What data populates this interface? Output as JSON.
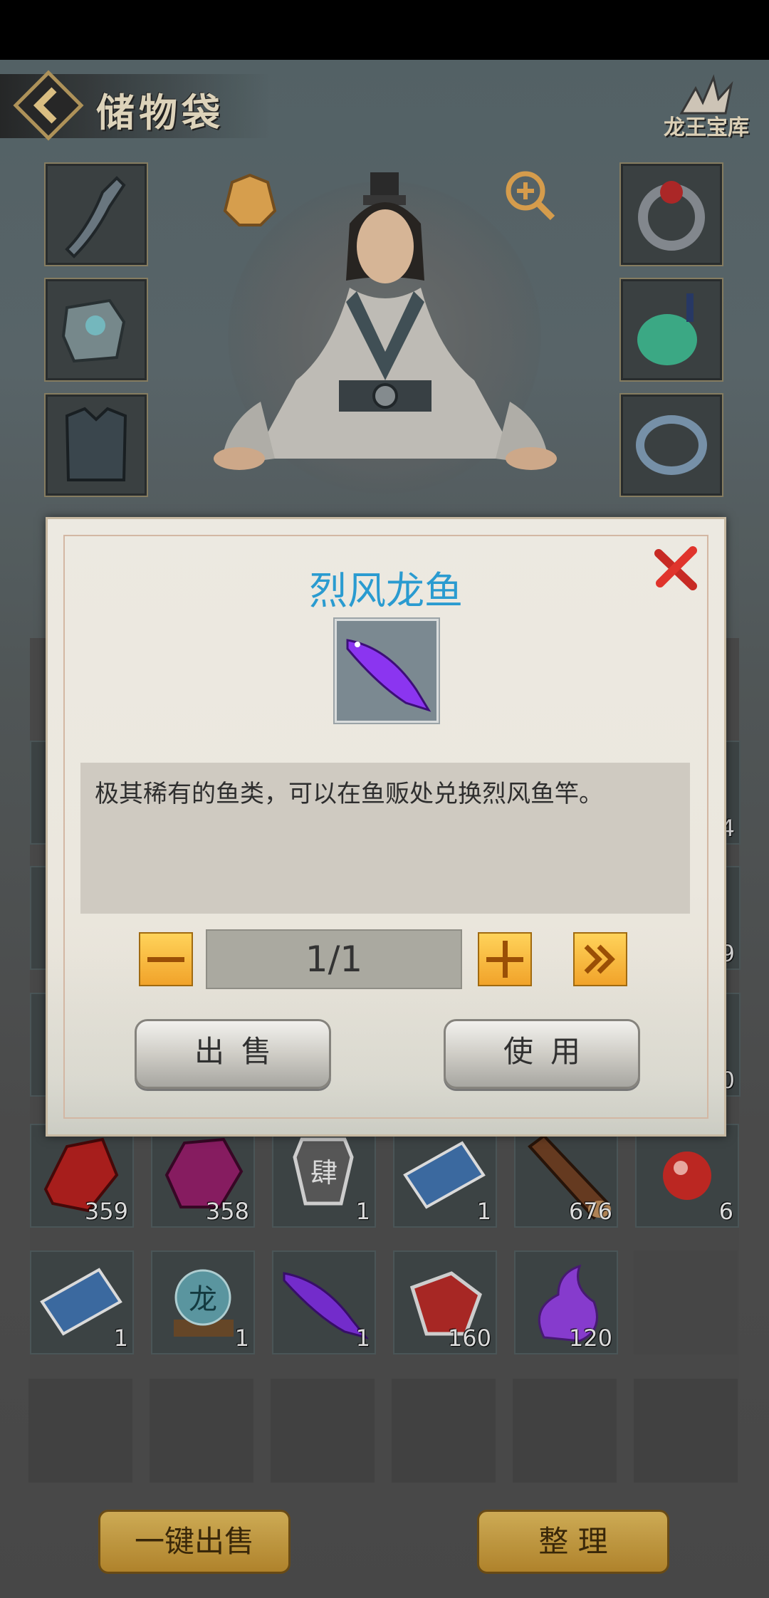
{
  "header": {
    "title": "储物袋",
    "treasury_label": "龙王宝库"
  },
  "equipment": {
    "left_slots": [
      "saber",
      "helmet",
      "armor"
    ],
    "right_slots": [
      "ring",
      "jade-pendant",
      "bracelet"
    ]
  },
  "inventory": {
    "rows": [
      [
        {
          "icon": "red-crystal-icon",
          "count": "359"
        },
        {
          "icon": "purple-gem-icon",
          "count": "358"
        },
        {
          "icon": "token-plaque-icon",
          "count": "1"
        },
        {
          "icon": "book-icon",
          "count": "1"
        },
        {
          "icon": "wood-log-icon",
          "count": "676"
        },
        {
          "icon": "red-pearl-icon",
          "count": "6"
        }
      ],
      [
        {
          "icon": "book-icon",
          "count": "1"
        },
        {
          "icon": "dragon-orb-icon",
          "count": "1"
        },
        {
          "icon": "purple-arowana-icon",
          "count": "1"
        },
        {
          "icon": "red-amulet-icon",
          "count": "160"
        },
        {
          "icon": "purple-flame-icon",
          "count": "120"
        }
      ]
    ],
    "hidden_counts": [
      "4",
      "9",
      "0"
    ]
  },
  "modal": {
    "title": "烈风龙鱼",
    "description": "极其稀有的鱼类，可以在鱼贩处兑换烈风鱼竿。",
    "quantity": "1/1",
    "sell_label": "出售",
    "use_label": "使用"
  },
  "footer": {
    "sell_all_label": "一键出售",
    "arrange_label": "整 理"
  },
  "colors": {
    "title_blue": "#2a9bd0",
    "gold_button": "#f1a32a",
    "close_red": "#d8322a"
  }
}
